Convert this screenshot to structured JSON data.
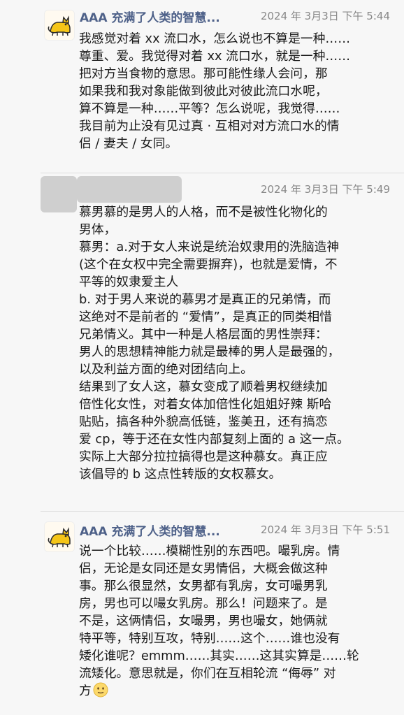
{
  "posts": [
    {
      "username": "AAA 充满了人类的智慧...",
      "time": "2024 年 3月3日 下午 5:44",
      "lines": [
        "我感觉对着 xx 流口水，怎么说也不算是一种……",
        "尊重、爱。我觉得对着 xx 流口水，就是一种……",
        "把对方当食物的意思。那可能性缘人会问，那",
        "如果我和我对象能做到彼此对彼此流口水呢，",
        "算不算是一种……平等？怎么说呢，我觉得……",
        "我目前为止没有见过真 · 互相对对方流口水的情",
        "侣 / 妻夫 / 女同。"
      ]
    },
    {
      "time": "2024 年 3月3日 下午 5:49",
      "lines": [
        "慕男慕的是男人的人格，而不是被性化物化的",
        "男体，",
        "慕男：a.对于女人来说是统治奴隶用的洗脑造神",
        "(这个在女权中完全需要摒弃)，也就是爱情，不",
        "平等的奴隶爱主人",
        "b. 对于男人来说的慕男才是真正的兄弟情，而",
        "这绝对不是前者的 “爱情”，是真正的同类相惜",
        "兄弟情义。其中一种是人格层面的男性崇拜：",
        "男人的思想精神能力就是最棒的男人是最强的，",
        "以及利益方面的绝对团结向上。",
        "结果到了女人这，慕女变成了顺着男权继续加",
        "倍性化女性，对着女体加倍性化姐姐好辣 斯哈",
        "贴贴，搞各种外貌高低链，鉴美丑，还有搞恋",
        "爱 cp，等于还在女性内部复刻上面的 a 这一点。",
        "实际上大部分拉拉搞得也是这种慕女。真正应",
        "该倡导的 b 这点性转版的女权慕女。"
      ]
    },
    {
      "username": "AAA 充满了人类的智慧...",
      "time": "2024 年 3月3日 下午 5:51",
      "lines": [
        "说一个比较……模糊性别的东西吧。嘬乳房。情",
        "侣，无论是女同还是女男情侣，大概会做这种",
        "事。那么很显然，女男都有乳房，女可嘬男乳",
        "房，男也可以嘬女乳房。那么！问题来了。是",
        "不是，这俩情侣，女嘬男，男也嘬女，她俩就",
        "特平等，特别互攻，特别……这个……谁也没有",
        "矮化谁呢？emmm……其实……这其实算是……轮",
        "流矮化。意思就是，你们在互相轮流 “侮辱” 对",
        "方"
      ]
    }
  ],
  "colors": {
    "username": "#4e6189",
    "background": "#f7f7f7",
    "timestamp": "#888888"
  },
  "icons": {
    "avatar": "yellow-cat-avatar-icon",
    "emoji": "awkward-smile-emoji-icon"
  }
}
